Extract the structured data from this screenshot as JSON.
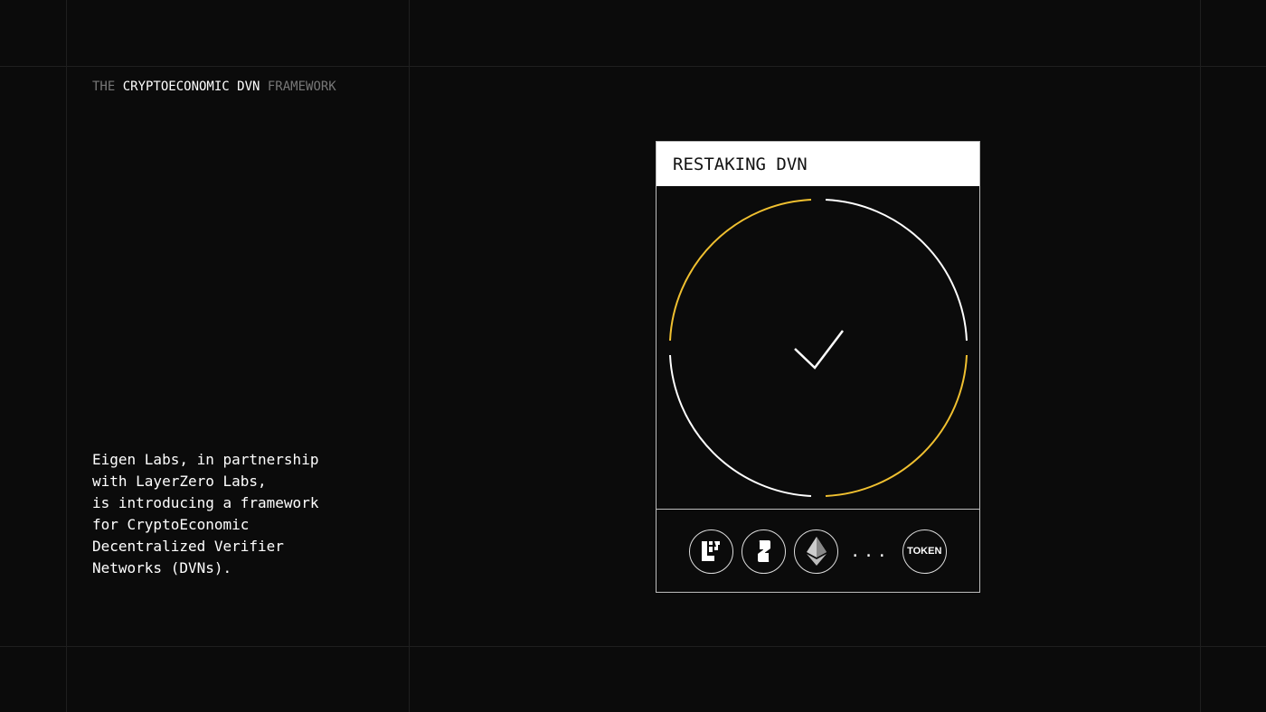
{
  "eyebrow": {
    "prefix": "THE ",
    "highlight": "CRYPTOECONOMIC DVN",
    "suffix": " FRAMEWORK"
  },
  "description": "Eigen Labs, in partnership\nwith LayerZero Labs,\nis introducing a framework\nfor CryptoEconomic\nDecentralized Verifier\nNetworks (DVNs).",
  "card": {
    "title": "RESTAKING DVN",
    "tokens": [
      {
        "icon": "eigenlayer-logo-icon"
      },
      {
        "icon": "layerzero-logo-icon"
      },
      {
        "icon": "ethereum-logo-icon"
      }
    ],
    "ellipsis": "...",
    "token_label": "TOKEN"
  },
  "colors": {
    "background": "#0b0b0b",
    "accent": "#f0c030",
    "line": "#ffffff"
  }
}
